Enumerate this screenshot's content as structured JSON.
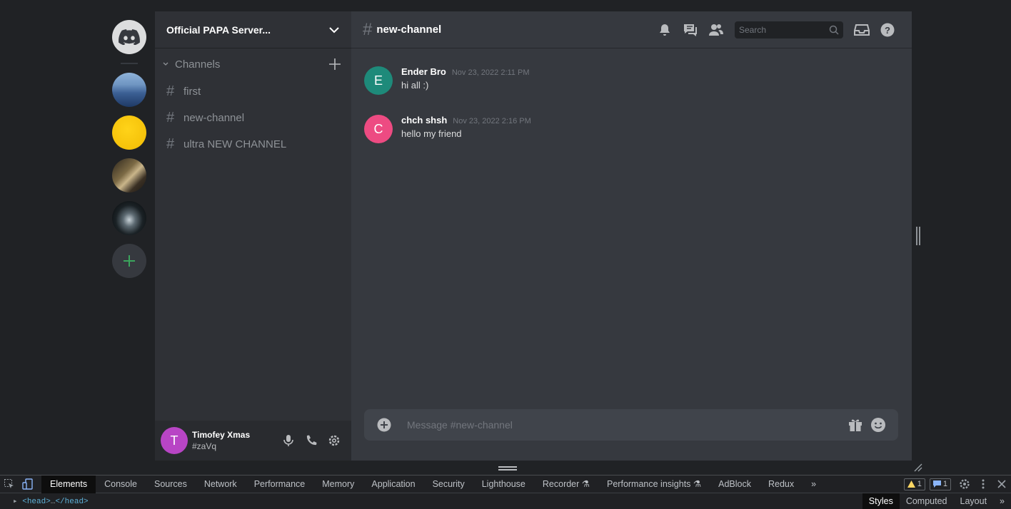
{
  "server_rail": {
    "servers": [
      {
        "icon": "discord-logo-icon",
        "name": "home"
      },
      {
        "icon": "mountain-landscape-avatar"
      },
      {
        "icon": "yellow-circle-avatar"
      },
      {
        "icon": "golden-abstract-avatar"
      },
      {
        "icon": "dark-wave-avatar"
      }
    ],
    "add_icon": "plus-icon"
  },
  "sidebar": {
    "server_name": "Official PAPA Server...",
    "category": "Channels",
    "channels": [
      {
        "name": "first"
      },
      {
        "name": "new-channel"
      },
      {
        "name": "ultra NEW CHANNEL"
      }
    ]
  },
  "user_panel": {
    "avatar_letter": "T",
    "name": "Timofey Xmas",
    "tag": "#zaVq",
    "avatar_color": "#b845c5"
  },
  "chat": {
    "channel_title": "new-channel",
    "search_placeholder": "Search",
    "messages": [
      {
        "avatar_letter": "E",
        "avatar_color": "#1e8a7a",
        "author": "Ender Bro",
        "time": "Nov 23, 2022 2:11 PM",
        "text": "hi all :)"
      },
      {
        "avatar_letter": "C",
        "avatar_color": "#ed4b82",
        "author": "chch shsh",
        "time": "Nov 23, 2022 2:16 PM",
        "text": "hello my friend"
      }
    ],
    "composer_placeholder": "Message #new-channel"
  },
  "devtools": {
    "tabs": [
      "Elements",
      "Console",
      "Sources",
      "Network",
      "Performance",
      "Memory",
      "Application",
      "Security",
      "Lighthouse",
      "Recorder",
      "Performance insights",
      "AdBlock",
      "Redux"
    ],
    "active_tab": "Elements",
    "warning_count": "1",
    "message_count": "1",
    "dom_node_open": "<head>",
    "dom_node_ellipsis": "…",
    "dom_node_close": "</head>",
    "side_tabs": [
      "Styles",
      "Computed",
      "Layout"
    ]
  },
  "colors": {
    "accent_green": "#3ba55d",
    "background": "#36393f",
    "sidebar": "#2f3136"
  }
}
